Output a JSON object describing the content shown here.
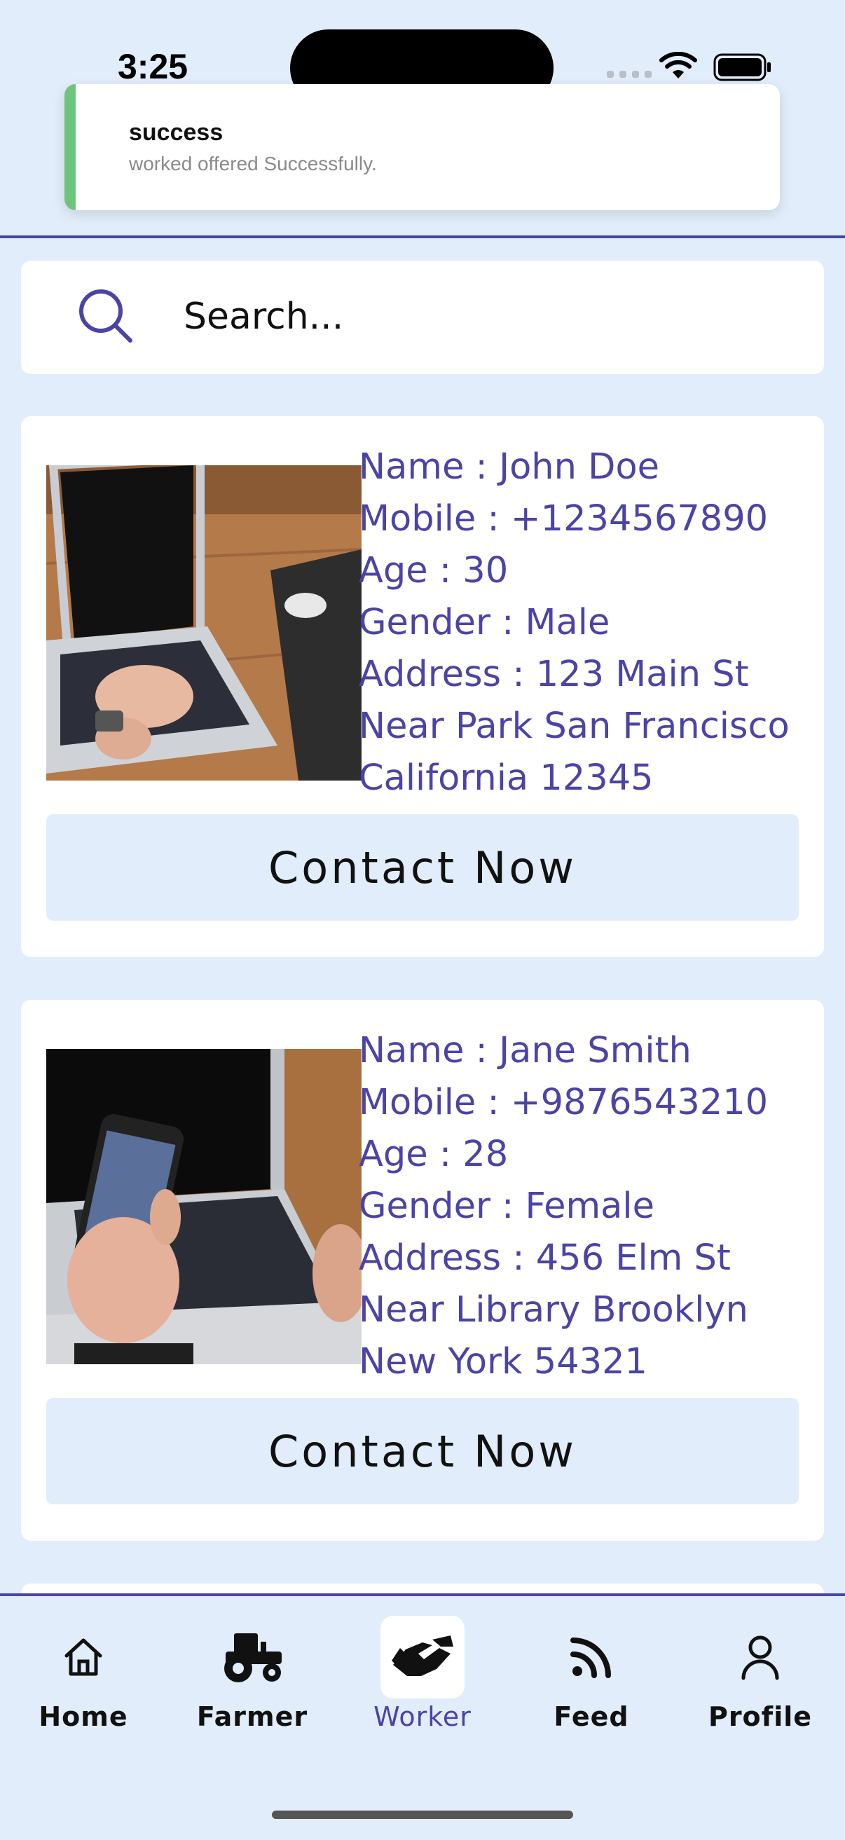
{
  "status_bar": {
    "time": "3:25"
  },
  "toast": {
    "title": "success",
    "message": "worked offered Successfully."
  },
  "search": {
    "placeholder": "Search..."
  },
  "workers": [
    {
      "name_line": "Name : John Doe",
      "mobile_line": "Mobile : +1234567890",
      "age_line": "Age : 30",
      "gender_line": "Gender : Male",
      "address_line": "Address : 123 Main St Near Park San Francisco California 12345",
      "button_label": "Contact Now"
    },
    {
      "name_line": "Name : Jane Smith",
      "mobile_line": "Mobile : +9876543210",
      "age_line": "Age : 28",
      "gender_line": "Gender : Female",
      "address_line": "Address : 456 Elm St Near Library Brooklyn New York 54321",
      "button_label": "Contact Now"
    }
  ],
  "nav": {
    "items": [
      {
        "label": "Home",
        "icon": "home-icon"
      },
      {
        "label": "Farmer",
        "icon": "tractor-icon"
      },
      {
        "label": "Worker",
        "icon": "handshake-icon",
        "active": true
      },
      {
        "label": "Feed",
        "icon": "rss-icon"
      },
      {
        "label": "Profile",
        "icon": "user-icon"
      }
    ]
  },
  "colors": {
    "accent": "#4b44a6",
    "background": "#e1edfa",
    "success": "#6dc47a"
  }
}
